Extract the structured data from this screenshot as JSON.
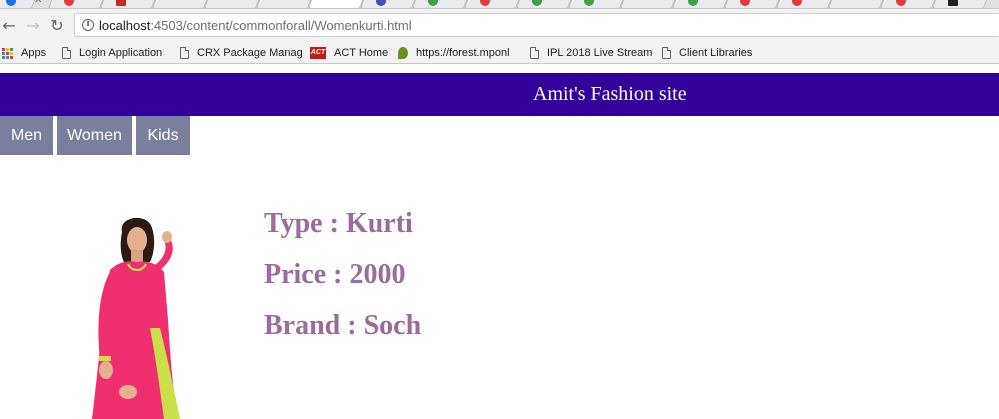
{
  "browser": {
    "url_host": "localhost",
    "url_rest": ":4503/content/commonforall/Womenkurti.html",
    "tab_favicon_colors": [
      "#1a73e8",
      "#e53935",
      "#c62828",
      "#9e9e9e",
      "#9e9e9e",
      "#9e9e9e",
      "#9e9e9e",
      "#3f51b5",
      "#43a047",
      "#e53935",
      "#43a047",
      "#43a047",
      "#9e9e9e",
      "#43a047",
      "#e53935",
      "#e53935",
      "#9e9e9e",
      "#e53935",
      "#212121"
    ],
    "bookmarks": [
      {
        "label": "Apps",
        "icon": "apps-grid-icon"
      },
      {
        "label": "Login Application",
        "icon": "page-icon"
      },
      {
        "label": "CRX Package Manag",
        "icon": "page-icon"
      },
      {
        "label": "ACT Home",
        "icon": "act-logo-icon",
        "logo_text": "ACT"
      },
      {
        "label": "https://forest.mponl",
        "icon": "leaf-icon"
      },
      {
        "label": "IPL 2018 Live Stream",
        "icon": "page-icon"
      },
      {
        "label": "Client Libraries",
        "icon": "page-icon"
      }
    ]
  },
  "site": {
    "title": "Amit's Fashion site",
    "header_color": "#330099",
    "nav": [
      {
        "label": "Men"
      },
      {
        "label": "Women"
      },
      {
        "label": "Kids"
      }
    ],
    "nav_color": "#7b7f9e"
  },
  "product": {
    "type": "Type : Kurti",
    "price": "Price : 2000",
    "brand": "Brand : Soch",
    "text_color": "#9a6b9c",
    "kurti_color": "#f0306e",
    "trim_color": "#c9e04a"
  }
}
